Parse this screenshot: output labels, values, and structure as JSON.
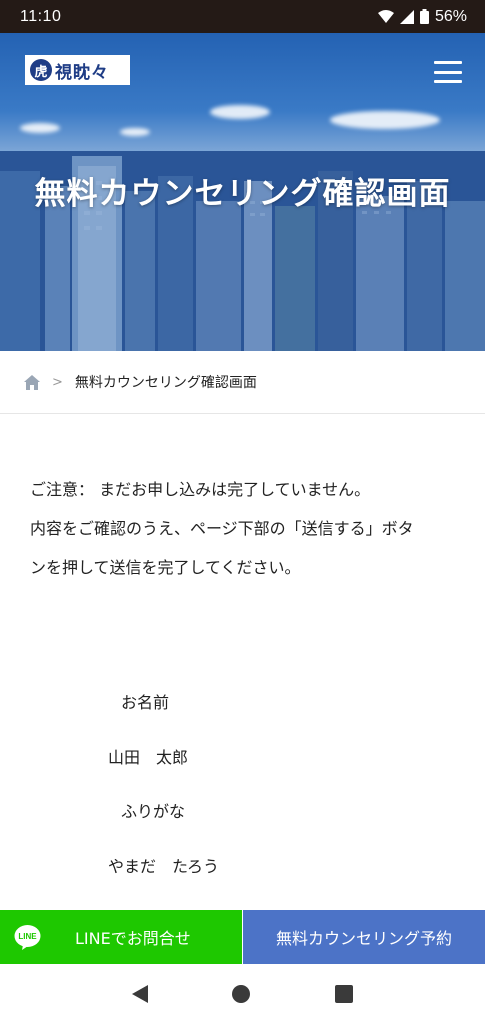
{
  "status_bar": {
    "time": "11:10",
    "battery": "56%",
    "icons": [
      "wifi-icon",
      "signal-icon",
      "battery-icon"
    ]
  },
  "header": {
    "logo_mark": "虎",
    "logo_text": "視眈々",
    "page_title": "無料カウンセリング確認画面"
  },
  "breadcrumb": {
    "separator": ">",
    "current": "無料カウンセリング確認画面"
  },
  "notice": {
    "line1": "ご注意：  まだお申し込みは完了していません。",
    "line2": "内容をご確認のうえ、ページ下部の「送信する」ボタ",
    "line3": "ンを押して送信を完了してください。"
  },
  "form": {
    "name_label": "お名前",
    "name_value": "山田　太郎",
    "kana_label": "ふりがな",
    "kana_value": "やまだ　たろう"
  },
  "bottom_bar": {
    "line_icon_text": "LINE",
    "line_label": "LINEでお問合せ",
    "counsel_label": "無料カウンセリング予約"
  },
  "colors": {
    "status_bar": "#241a16",
    "line_green": "#1ec800",
    "counsel_blue": "#4c73c7",
    "logo_navy": "#1f3d86"
  }
}
